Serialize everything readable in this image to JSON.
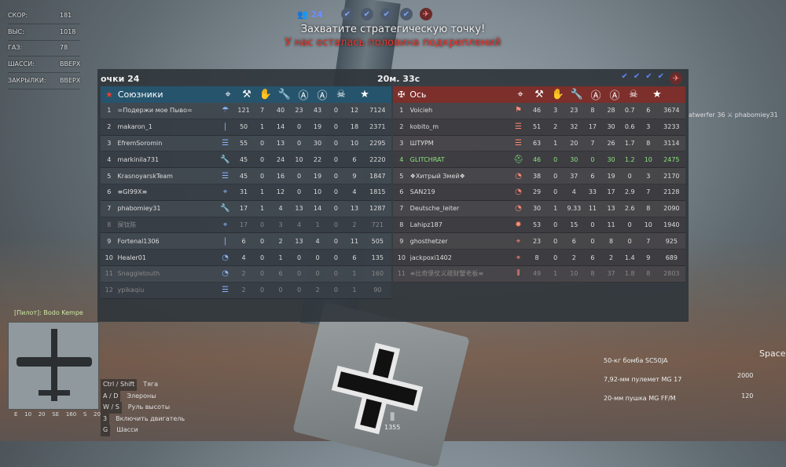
{
  "hud": [
    {
      "k": "СКОР:",
      "v": "181"
    },
    {
      "k": "ВЫС:",
      "v": "1018"
    },
    {
      "k": "ГАЗ:",
      "v": "78"
    },
    {
      "k": "ШАССИ:",
      "v": "ВВЕРХ"
    },
    {
      "k": "ЗАКРЫЛКИ:",
      "v": "ВВЕРХ"
    }
  ],
  "players_count": "24",
  "msg_capture": "Захватите стратегическую точку!",
  "msg_reinforce": "У нас осталась половина подкреплений",
  "score_label": "очки 24",
  "timer": "20м. 33с",
  "allies": {
    "name": "Союзники",
    "rows": [
      {
        "n": "1",
        "name": "=Подержи мое Пыво=",
        "vals": [
          "121",
          "7",
          "40",
          "23",
          "43",
          "0",
          "12",
          "7124"
        ],
        "icon": "parachute",
        "cls": ""
      },
      {
        "n": "2",
        "name": "makaron_1",
        "vals": [
          "50",
          "1",
          "14",
          "0",
          "19",
          "0",
          "18",
          "2371"
        ],
        "icon": "bullet",
        "cls": ""
      },
      {
        "n": "3",
        "name": "EfremSoromin",
        "vals": [
          "55",
          "0",
          "13",
          "0",
          "30",
          "0",
          "10",
          "2295"
        ],
        "icon": "list",
        "cls": ""
      },
      {
        "n": "4",
        "name": "markinila731",
        "vals": [
          "45",
          "0",
          "24",
          "10",
          "22",
          "0",
          "6",
          "2220"
        ],
        "icon": "wrench",
        "cls": ""
      },
      {
        "n": "5",
        "name": "KrasnoyarskTeam",
        "vals": [
          "45",
          "0",
          "16",
          "0",
          "19",
          "0",
          "9",
          "1847"
        ],
        "icon": "list",
        "cls": ""
      },
      {
        "n": "6",
        "name": "≡GI99X≡",
        "vals": [
          "31",
          "1",
          "12",
          "0",
          "10",
          "0",
          "4",
          "1815"
        ],
        "icon": "target",
        "cls": ""
      },
      {
        "n": "7",
        "name": "phabomiey31",
        "vals": [
          "17",
          "1",
          "4",
          "13",
          "14",
          "0",
          "13",
          "1287"
        ],
        "icon": "wrench",
        "cls": ""
      },
      {
        "n": "8",
        "name": "屎钛陈",
        "vals": [
          "17",
          "0",
          "3",
          "4",
          "1",
          "0",
          "2",
          "721"
        ],
        "icon": "target",
        "cls": "dim"
      },
      {
        "n": "9",
        "name": "Fortenal1306",
        "vals": [
          "6",
          "0",
          "2",
          "13",
          "4",
          "0",
          "11",
          "505"
        ],
        "icon": "bullet",
        "cls": ""
      },
      {
        "n": "10",
        "name": "Healer01",
        "vals": [
          "4",
          "0",
          "1",
          "0",
          "0",
          "0",
          "6",
          "135"
        ],
        "icon": "gauge",
        "cls": ""
      },
      {
        "n": "11",
        "name": "Snaggletouth",
        "vals": [
          "2",
          "0",
          "6",
          "0",
          "0",
          "0",
          "1",
          "160"
        ],
        "icon": "gauge",
        "cls": "dim"
      },
      {
        "n": "12",
        "name": "ypikaqiu",
        "vals": [
          "2",
          "0",
          "0",
          "0",
          "2",
          "0",
          "1",
          "90"
        ],
        "icon": "list",
        "cls": "dim"
      }
    ]
  },
  "axis": {
    "name": "Ось",
    "rows": [
      {
        "n": "1",
        "name": "Voicieh",
        "vals": [
          "46",
          "3",
          "23",
          "8",
          "28",
          "0.7",
          "6",
          "3674"
        ],
        "icon": "torch",
        "cls": ""
      },
      {
        "n": "2",
        "name": "kobito_m",
        "vals": [
          "51",
          "2",
          "32",
          "17",
          "30",
          "0.6",
          "3",
          "3233"
        ],
        "icon": "stack",
        "cls": ""
      },
      {
        "n": "3",
        "name": "ШТУРМ",
        "vals": [
          "63",
          "1",
          "20",
          "7",
          "26",
          "1.7",
          "8",
          "3114"
        ],
        "icon": "list",
        "cls": ""
      },
      {
        "n": "4",
        "name": "GLITCHRAT",
        "vals": [
          "46",
          "0",
          "30",
          "0",
          "30",
          "1.2",
          "10",
          "2475"
        ],
        "icon": "helmet",
        "cls": "green"
      },
      {
        "n": "5",
        "name": "❖Хитрый Змей❖",
        "vals": [
          "38",
          "0",
          "37",
          "6",
          "19",
          "0",
          "3",
          "2170"
        ],
        "icon": "gauge",
        "cls": ""
      },
      {
        "n": "6",
        "name": "SAN219",
        "vals": [
          "29",
          "0",
          "4",
          "33",
          "17",
          "2.9",
          "7",
          "2128"
        ],
        "icon": "gauge",
        "cls": ""
      },
      {
        "n": "7",
        "name": "Deutsche_leiter",
        "vals": [
          "30",
          "1",
          "9.33",
          "11",
          "13",
          "2.6",
          "8",
          "2090"
        ],
        "icon": "gauge",
        "cls": ""
      },
      {
        "n": "8",
        "name": "Lahipz187",
        "vals": [
          "53",
          "0",
          "15",
          "0",
          "11",
          "0",
          "10",
          "1940"
        ],
        "icon": "fire",
        "cls": ""
      },
      {
        "n": "9",
        "name": "ghosthetzer",
        "vals": [
          "23",
          "0",
          "6",
          "0",
          "8",
          "0",
          "7",
          "925"
        ],
        "icon": "target",
        "cls": ""
      },
      {
        "n": "10",
        "name": "jackpoxi1402",
        "vals": [
          "8",
          "0",
          "2",
          "6",
          "2",
          "1.4",
          "9",
          "689"
        ],
        "icon": "target",
        "cls": ""
      },
      {
        "n": "11",
        "name": "≡比奇堡仗义疏财蟹老板≡",
        "vals": [
          "49",
          "1",
          "10",
          "8",
          "37",
          "1.8",
          "8",
          "2803"
        ],
        "icon": "ammo",
        "cls": "dim"
      }
    ]
  },
  "pilot": "[Пилот]: Bodo Kempe",
  "compass": [
    "E",
    "10",
    "20",
    "SE",
    "160",
    "S",
    "20"
  ],
  "controls": [
    {
      "k": "Ctrl / Shift",
      "v": "Тяга"
    },
    {
      "k": "A / D",
      "v": "Элероны"
    },
    {
      "k": "W / S",
      "v": "Руль высоты"
    },
    {
      "k": "3",
      "v": "Включить двигатель"
    },
    {
      "k": "G",
      "v": "Шасси"
    }
  ],
  "weapons": [
    "50-кг бомба SC50JA",
    "7,92-мм пулемет MG 17",
    "20-мм пушка MG FF/M"
  ],
  "weapon_vals": [
    "2000",
    "120"
  ],
  "space_label": "Space",
  "ammo_count": "1355",
  "side_msg": "atwerfer 36 ⚔ phabomiey31"
}
